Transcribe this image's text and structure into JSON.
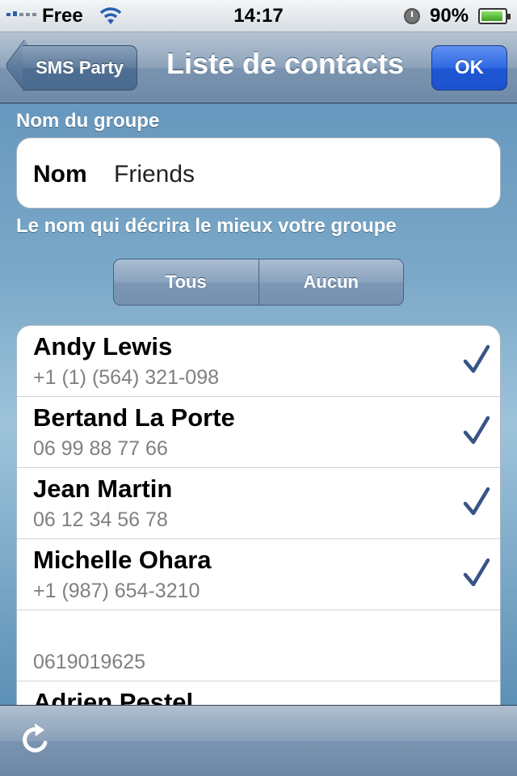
{
  "status_bar": {
    "carrier": "Free",
    "time": "14:17",
    "battery_percent": "90%",
    "icons": [
      "signal-icon",
      "wifi-icon",
      "alarm-icon",
      "battery-icon"
    ]
  },
  "nav": {
    "back_label": "SMS Party",
    "title": "Liste de contacts",
    "ok_label": "OK"
  },
  "group": {
    "header": "Nom du groupe",
    "field_label": "Nom",
    "field_value": "Friends",
    "footer": "Le nom qui décrira le mieux votre groupe"
  },
  "selector": {
    "all_label": "Tous",
    "none_label": "Aucun"
  },
  "contacts": [
    {
      "name": "Andy Lewis",
      "phone": "+1 (1) (564) 321-098",
      "checked": true
    },
    {
      "name": "Bertand La Porte",
      "phone": "06 99 88 77 66",
      "checked": true
    },
    {
      "name": "Jean Martin",
      "phone": "06 12 34 56 78",
      "checked": true
    },
    {
      "name": "Michelle Ohara",
      "phone": "+1 (987) 654-3210",
      "checked": true
    },
    {
      "name": "",
      "phone": "0619019625",
      "checked": false
    },
    {
      "name": "Adrien Pestel",
      "phone": "",
      "checked": false
    }
  ],
  "colors": {
    "ok_button": "#2f6ae2",
    "checkmark": "#385487",
    "nav_bar": "#7b94b0"
  }
}
